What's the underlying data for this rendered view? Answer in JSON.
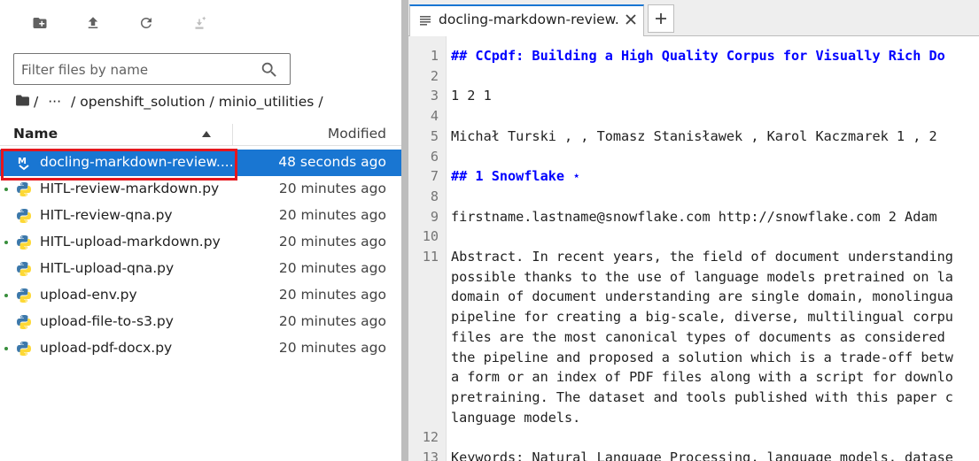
{
  "toolbar": {
    "new_folder_icon": "new-folder-icon",
    "upload_icon": "upload-icon",
    "refresh_icon": "refresh-icon",
    "git_clone_icon": "git-clone-icon"
  },
  "filter": {
    "placeholder": "Filter files by name"
  },
  "breadcrumb": {
    "root_sep": "/",
    "ellipsis": "···",
    "sep": "/",
    "folder1": "openshift_solution",
    "folder2": "minio_utilities",
    "trail": "/"
  },
  "columns": {
    "name": "Name",
    "modified": "Modified"
  },
  "files": [
    {
      "name": "docling-markdown-review....",
      "modified": "48 seconds ago",
      "type": "markdown",
      "selected": true,
      "running": false
    },
    {
      "name": "HITL-review-markdown.py",
      "modified": "20 minutes ago",
      "type": "python",
      "selected": false,
      "running": true
    },
    {
      "name": "HITL-review-qna.py",
      "modified": "20 minutes ago",
      "type": "python",
      "selected": false,
      "running": false
    },
    {
      "name": "HITL-upload-markdown.py",
      "modified": "20 minutes ago",
      "type": "python",
      "selected": false,
      "running": true
    },
    {
      "name": "HITL-upload-qna.py",
      "modified": "20 minutes ago",
      "type": "python",
      "selected": false,
      "running": false
    },
    {
      "name": "upload-env.py",
      "modified": "20 minutes ago",
      "type": "python",
      "selected": false,
      "running": true
    },
    {
      "name": "upload-file-to-s3.py",
      "modified": "20 minutes ago",
      "type": "python",
      "selected": false,
      "running": false
    },
    {
      "name": "upload-pdf-docx.py",
      "modified": "20 minutes ago",
      "type": "python",
      "selected": false,
      "running": true
    }
  ],
  "tab": {
    "label": "docling-markdown-review.md",
    "icon": "text-file-icon",
    "close_icon": "close-icon"
  },
  "new_tab_icon": "plus-icon",
  "colors": {
    "accent": "#1976d2",
    "highlight": "#e5161d",
    "heading": "#0000ff"
  },
  "editor": {
    "lines": [
      {
        "n": "1",
        "heading": true,
        "rows": [
          "## CCpdf: Building a High Quality Corpus for Visually Rich Do"
        ]
      },
      {
        "n": "2",
        "heading": false,
        "rows": [
          ""
        ]
      },
      {
        "n": "3",
        "heading": false,
        "rows": [
          "1 2 1"
        ]
      },
      {
        "n": "4",
        "heading": false,
        "rows": [
          ""
        ]
      },
      {
        "n": "5",
        "heading": false,
        "rows": [
          "Michał Turski , , Tomasz Stanisławek , Karol Kaczmarek 1 , 2"
        ]
      },
      {
        "n": "6",
        "heading": false,
        "rows": [
          ""
        ]
      },
      {
        "n": "7",
        "heading": true,
        "rows": [
          "## 1 Snowflake ⋆"
        ]
      },
      {
        "n": "8",
        "heading": false,
        "rows": [
          ""
        ]
      },
      {
        "n": "9",
        "heading": false,
        "rows": [
          "firstname.lastname@snowflake.com http://snowflake.com 2 Adam "
        ]
      },
      {
        "n": "10",
        "heading": false,
        "rows": [
          ""
        ]
      },
      {
        "n": "11",
        "heading": false,
        "rows": [
          "Abstract. In recent years, the field of document understanding",
          "possible thanks to the use of language models pretrained on la",
          "domain of document understanding are single domain, monolingua",
          "pipeline for creating a big-scale, diverse, multilingual corpu",
          "files are the most canonical types of documents as considered ",
          "the pipeline and proposed a solution which is a trade-off betw",
          "a form or an index of PDF files along with a script for downlo",
          "pretraining. The dataset and tools published with this paper c",
          "language models."
        ]
      },
      {
        "n": "12",
        "heading": false,
        "rows": [
          ""
        ]
      },
      {
        "n": "13",
        "heading": false,
        "rows": [
          "Keywords: Natural Language Processing, language models, datase"
        ]
      }
    ]
  }
}
